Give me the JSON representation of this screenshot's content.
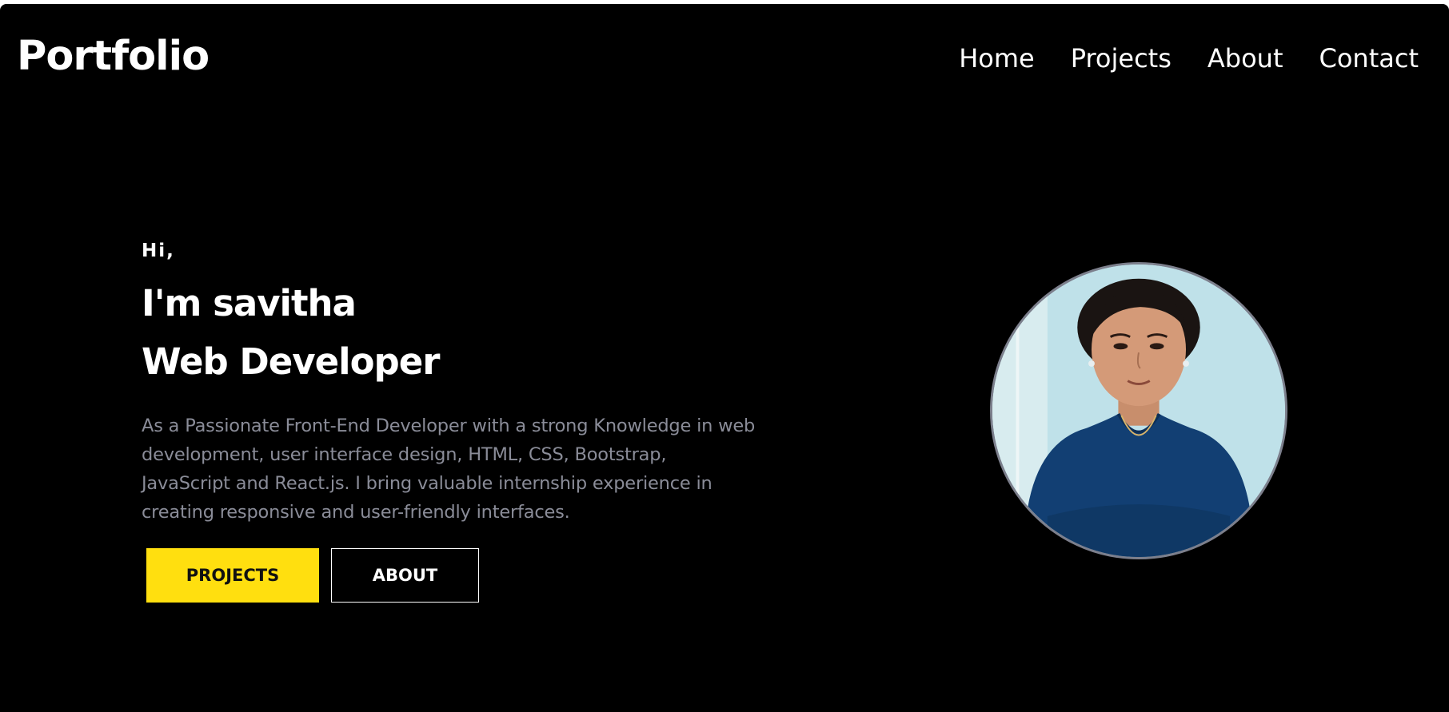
{
  "header": {
    "logo": "Portfolio",
    "nav": [
      {
        "label": "Home"
      },
      {
        "label": "Projects"
      },
      {
        "label": "About"
      },
      {
        "label": "Contact"
      }
    ]
  },
  "hero": {
    "greeting": "Hi,",
    "name": "I'm savitha",
    "role": "Web Developer",
    "description": "As a Passionate Front-End Developer with a strong Knowledge in web development, user interface design, HTML, CSS, Bootstrap, JavaScript and React.js. I bring valuable internship experience in creating responsive and user-friendly interfaces.",
    "buttons": {
      "projects": "PROJECTS",
      "about": "ABOUT"
    },
    "avatar_icon": "profile-photo"
  },
  "colors": {
    "background": "#000000",
    "accent": "#ffdf0f",
    "text": "#ffffff",
    "muted_text": "#8a8c98"
  }
}
